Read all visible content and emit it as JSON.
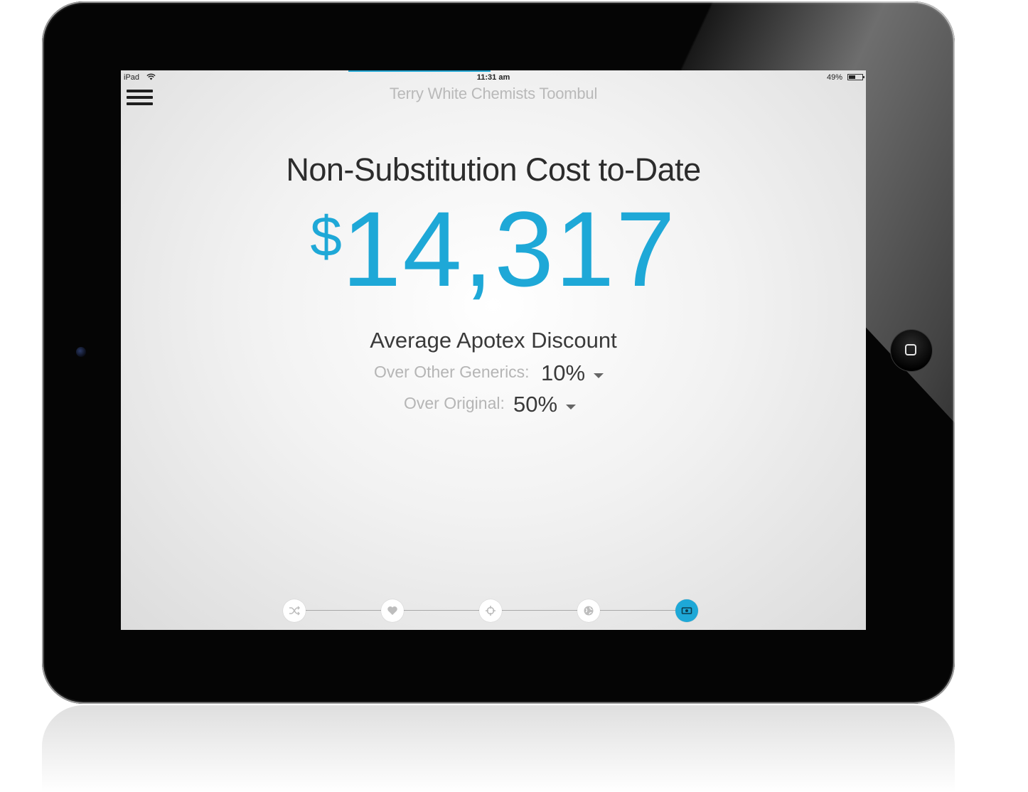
{
  "status_bar": {
    "device": "iPad",
    "time": "11:31 am",
    "battery_percent": "49%",
    "battery_level": 0.49
  },
  "header": {
    "store_name": "Terry White Chemists Toombul",
    "menu_icon": "hamburger-menu-icon"
  },
  "main": {
    "headline": "Non-Substitution Cost to-Date",
    "currency_symbol": "$",
    "amount": "14,317",
    "discount_title": "Average Apotex Discount",
    "discounts": [
      {
        "label": "Over Other Generics:",
        "value": "10%"
      },
      {
        "label": "Over Original:",
        "value": "50%"
      }
    ]
  },
  "bottom_nav": {
    "items": [
      {
        "icon": "shuffle-icon",
        "active": false
      },
      {
        "icon": "heart-icon",
        "active": false
      },
      {
        "icon": "target-icon",
        "active": false
      },
      {
        "icon": "globe-icon",
        "active": false
      },
      {
        "icon": "money-icon",
        "active": true
      }
    ]
  },
  "colors": {
    "accent": "#1ea8d7",
    "bezel": "#050505",
    "headline_text": "#2c2c2c",
    "muted_text": "#b5b5b5"
  }
}
